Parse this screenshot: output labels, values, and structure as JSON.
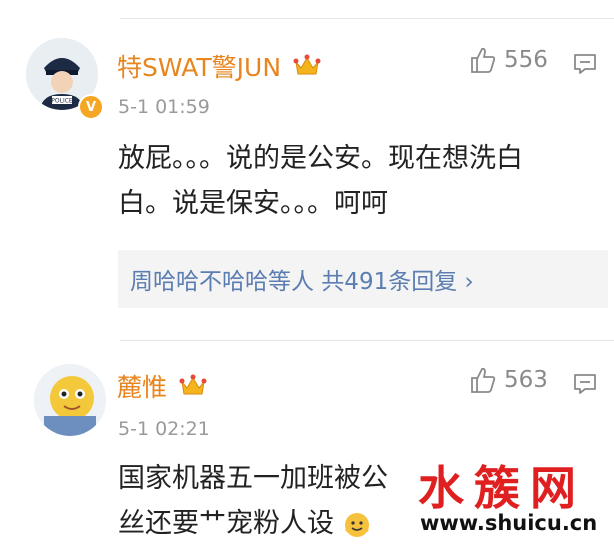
{
  "comments": [
    {
      "username": "特SWAT警JUN",
      "time": "5-1 01:59",
      "likes": "556",
      "verified": "V",
      "body_lines": [
        "放屁。。。说的是公安。现在想洗白",
        "白。说是保安。。。呵呵"
      ],
      "replies_text": "周哈哈不哈哈等人 共491条回复 ›"
    },
    {
      "username": "麓惟",
      "time": "5-1 02:21",
      "likes": "563",
      "body_lines": [
        "国家机器五一加班被公",
        "丝还要艹宠粉人设"
      ]
    }
  ],
  "avatar_label": "POLICE",
  "watermark": {
    "chinese": "水簇网",
    "url": "www.shuicu.cn"
  },
  "colors": {
    "username": "#e8851f",
    "link": "#5b7db1",
    "watermark": "#e02020"
  },
  "icons": [
    "thumbs-up-icon",
    "reply-icon",
    "crown-icon",
    "verified-badge"
  ]
}
